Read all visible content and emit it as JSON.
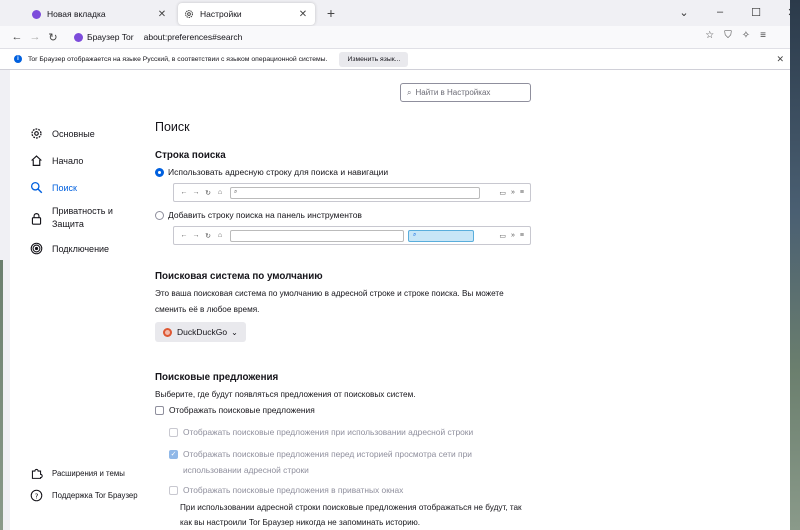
{
  "tabs": [
    {
      "title": "Новая вкладка",
      "icon": "tor-icon",
      "active": false
    },
    {
      "title": "Настройки",
      "icon": "gear-icon",
      "active": true
    }
  ],
  "window_controls": {
    "minimize": "–",
    "maximize": "☐",
    "close": "✕",
    "chevron": "⌄"
  },
  "urlbar": {
    "identity": "Браузер Tor",
    "url": "about:preferences#search"
  },
  "notification": {
    "text": "Tor Браузер отображается на языке Русский, в соответствии с языком операционной системы.",
    "button": "Изменить язык..."
  },
  "search_placeholder": "Найти в Настройках",
  "sidebar": {
    "items": [
      {
        "label": "Основные",
        "icon": "gear-icon"
      },
      {
        "label": "Начало",
        "icon": "home-icon"
      },
      {
        "label": "Поиск",
        "icon": "search-icon",
        "active": true
      },
      {
        "label": "Приватность и Защита",
        "icon": "lock-icon"
      },
      {
        "label": "Подключение",
        "icon": "onion-icon"
      }
    ],
    "bottom": [
      {
        "label": "Расширения и темы",
        "icon": "puzzle-icon"
      },
      {
        "label": "Поддержка Tor Браузер",
        "icon": "help-icon"
      }
    ]
  },
  "main": {
    "title": "Поиск",
    "search_bar": {
      "heading": "Строка поиска",
      "option1": "Использовать адресную строку для поиска и навигации",
      "option2": "Добавить строку поиска на панель инструментов"
    },
    "default_engine": {
      "heading": "Поисковая система по умолчанию",
      "desc": "Это ваша поисковая система по умолчанию в адресной строке и строке поиска. Вы можете сменить её в любое время.",
      "selected": "DuckDuckGo"
    },
    "suggestions": {
      "heading": "Поисковые предложения",
      "desc": "Выберите, где будут появляться предложения от поисковых систем.",
      "show": "Отображать поисковые предложения",
      "in_urlbar": "Отображать поисковые предложения при использовании адресной строки",
      "before_history": "Отображать поисковые предложения перед историей просмотра сети при использовании адресной строки",
      "private": "Отображать поисковые предложения в приватных окнах",
      "note": "При использовании адресной строки поисковые предложения отображаться не будут, так как вы настроили Tor Браузер никогда не запоминать историю."
    }
  }
}
